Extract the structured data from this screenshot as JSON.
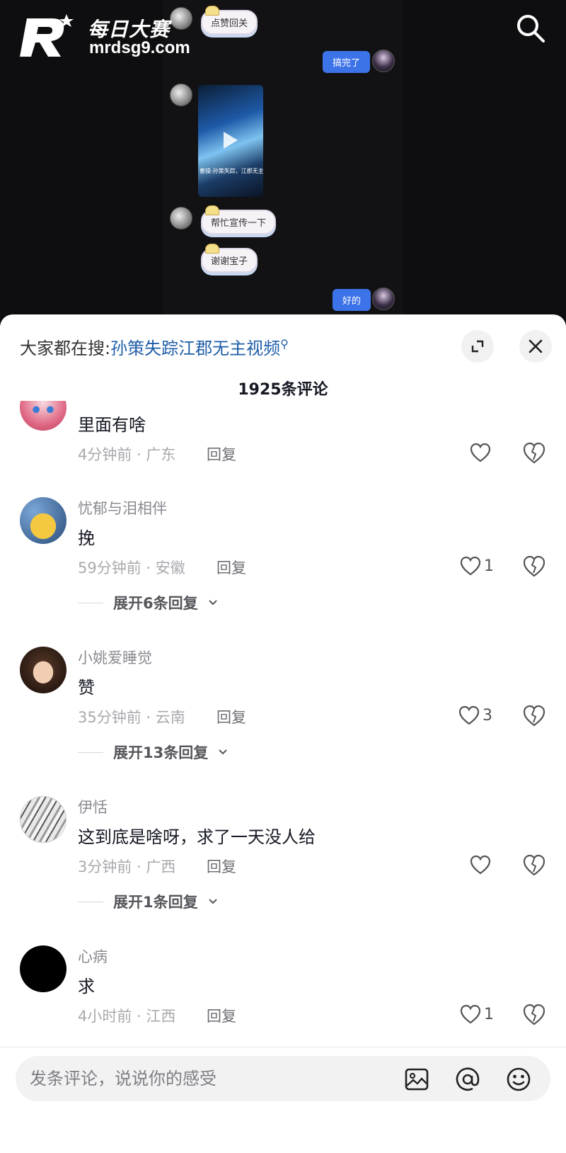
{
  "logo": {
    "cn": "每日大赛",
    "url": "mrdsg9.com"
  },
  "chat": {
    "sticker_1": "点赞回关",
    "my_msg_1": "搞完了",
    "video_caption": "曹操:孙策失踪，江郡无主",
    "sticker_2": "帮忙宣传一下",
    "sticker_3": "谢谢宝子",
    "my_msg_2": "好的"
  },
  "sheet": {
    "search_prefix": "大家都在搜:",
    "search_keyword": "孙策失踪江郡无主视频",
    "title": "1925条评论"
  },
  "comments": [
    {
      "user": "",
      "text": "里面有啥",
      "time_loc": "4分钟前 · 广东",
      "reply": "回复",
      "likes": "",
      "expand": ""
    },
    {
      "user": "忧郁与泪相伴",
      "text": "挽",
      "time_loc": "59分钟前 · 安徽",
      "reply": "回复",
      "likes": "1",
      "expand": "展开6条回复"
    },
    {
      "user": "小姚爱睡觉",
      "text": "赞",
      "time_loc": "35分钟前 · 云南",
      "reply": "回复",
      "likes": "3",
      "expand": "展开13条回复"
    },
    {
      "user": "伊恬",
      "text": "这到底是啥呀，求了一天没人给",
      "time_loc": "3分钟前 · 广西",
      "reply": "回复",
      "likes": "",
      "expand": "展开1条回复"
    },
    {
      "user": "心病",
      "text": "求",
      "time_loc": "4小时前 · 江西",
      "reply": "回复",
      "likes": "1",
      "expand": ""
    }
  ],
  "input": {
    "placeholder": "发条评论，说说你的感受"
  },
  "colors": {
    "accent_blue": "#3d73e8",
    "keyword_blue": "#1f5ea8",
    "sheet_bg": "#ffffff",
    "dark_bg": "#0e0e10"
  }
}
